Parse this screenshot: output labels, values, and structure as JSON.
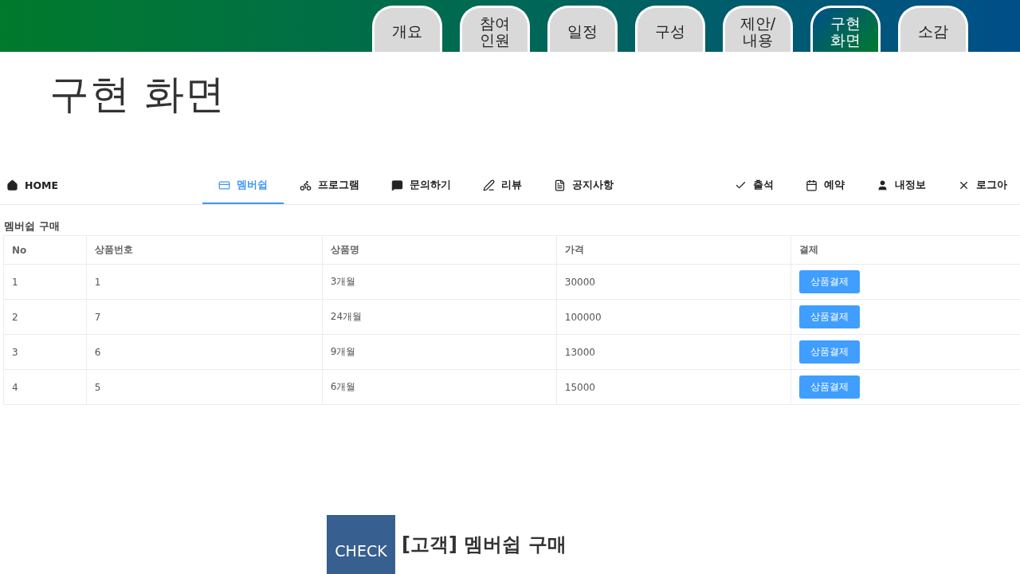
{
  "slide_tabs": [
    {
      "label": "개요",
      "selected": false
    },
    {
      "label": "참여\n인원",
      "selected": false
    },
    {
      "label": "일정",
      "selected": false
    },
    {
      "label": "구성",
      "selected": false
    },
    {
      "label": "제안/\n내용",
      "selected": false
    },
    {
      "label": "구현\n화면",
      "selected": true
    },
    {
      "label": "소감",
      "selected": false
    }
  ],
  "title": "구현 화면",
  "app_nav": {
    "home": {
      "label": "HOME"
    },
    "center": [
      {
        "label": "멤버쉽",
        "selected": true
      },
      {
        "label": "프로그램",
        "selected": false
      },
      {
        "label": "문의하기",
        "selected": false
      },
      {
        "label": "리뷰",
        "selected": false
      },
      {
        "label": "공지사항",
        "selected": false
      }
    ],
    "right": [
      {
        "label": "출석"
      },
      {
        "label": "예약"
      },
      {
        "label": "내정보"
      },
      {
        "label": "로그아"
      }
    ]
  },
  "section_title": "멤버쉽 구매",
  "table": {
    "columns": [
      "No",
      "상품번호",
      "상품명",
      "가격",
      "결제"
    ],
    "rows": [
      {
        "cells": [
          "1",
          "1",
          "3개월",
          "30000"
        ],
        "button": "상품결제"
      },
      {
        "cells": [
          "2",
          "7",
          "24개월",
          "100000"
        ],
        "button": "상품결제"
      },
      {
        "cells": [
          "3",
          "6",
          "9개월",
          "13000"
        ],
        "button": "상품결제"
      },
      {
        "cells": [
          "4",
          "5",
          "6개월",
          "15000"
        ],
        "button": "상품결제"
      }
    ]
  },
  "check": {
    "badge": "CHECK",
    "text": "[고객] 멤버쉽 구매"
  }
}
